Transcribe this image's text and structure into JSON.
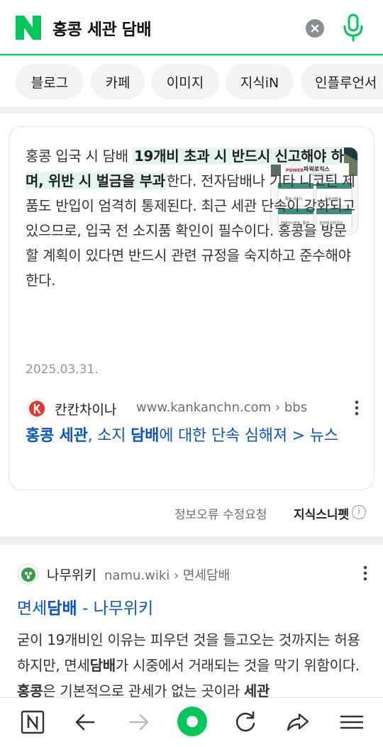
{
  "header": {
    "logo_letter": "N",
    "query": "홍콩 세관 담배",
    "clear_icon": "close-icon",
    "mic_icon": "microphone-icon",
    "brand_color": "#03c75a"
  },
  "tabs": [
    "블로그",
    "카페",
    "이미지",
    "지식iN",
    "인플루언서"
  ],
  "snippet": {
    "text_pre": "홍콩 입국 시 담배 ",
    "text_highlight": "19개비 초과 시 반드시 신고해야 하며, 위반 시 벌금을 부과",
    "text_post": "한다. 전자담배나 기타 니코틴 제품도 반입이 엄격히 통제된다. 최근 세관 단속이 강화되고 있으므로, 입국 전 소지품 확인이 필수이다. 홍콩을 방문할 계획이 있다면 반드시 관련 규정을 숙지하고 준수해야 한다.",
    "thumbnail": {
      "brand": "파워로직스",
      "brand_en": "POWER LOGIS",
      "cells": [
        "특송 서비스",
        "운송서비스",
        "컨테이너부킹, 통관",
        "전자제 인터운드"
      ]
    },
    "date": "2025.03.31.",
    "source_name": "칸칸차이나",
    "source_url": "www.kankanchn.com › bbs",
    "link_parts": [
      {
        "t": "홍콩 세관",
        "b": true
      },
      {
        "t": ", 소지 ",
        "b": false
      },
      {
        "t": "담배",
        "b": true
      },
      {
        "t": "에 대한 단속 심해져 > 뉴스",
        "b": false
      }
    ],
    "report_label": "정보오류 수정요청",
    "feature_label": "지식스니펫",
    "info_icon": "info-icon"
  },
  "namu": {
    "source_name": "나무위키",
    "source_url": "namu.wiki › 면세담배",
    "title_parts": [
      {
        "t": "면세",
        "b": false
      },
      {
        "t": "담배",
        "b": true
      },
      {
        "t": " - 나무위키",
        "b": false
      }
    ],
    "body_parts": [
      {
        "t": "굳이 19개비인 이유는 피우던 것을 들고오는 것까지는 허용하지만, 면세",
        "b": false
      },
      {
        "t": "담배",
        "b": true
      },
      {
        "t": "가 시중에서 거래되는 것을 막기 위함이다. ",
        "b": false
      },
      {
        "t": "홍콩",
        "b": true
      },
      {
        "t": "은 기본적으로 관세가 없는 곳이라 ",
        "b": false
      },
      {
        "t": "세관",
        "b": true
      }
    ]
  },
  "bottombar": {
    "icons": [
      "naver-home-icon",
      "back-arrow-icon",
      "forward-arrow-icon",
      "green-dot-icon",
      "refresh-icon",
      "share-icon",
      "menu-icon"
    ]
  }
}
